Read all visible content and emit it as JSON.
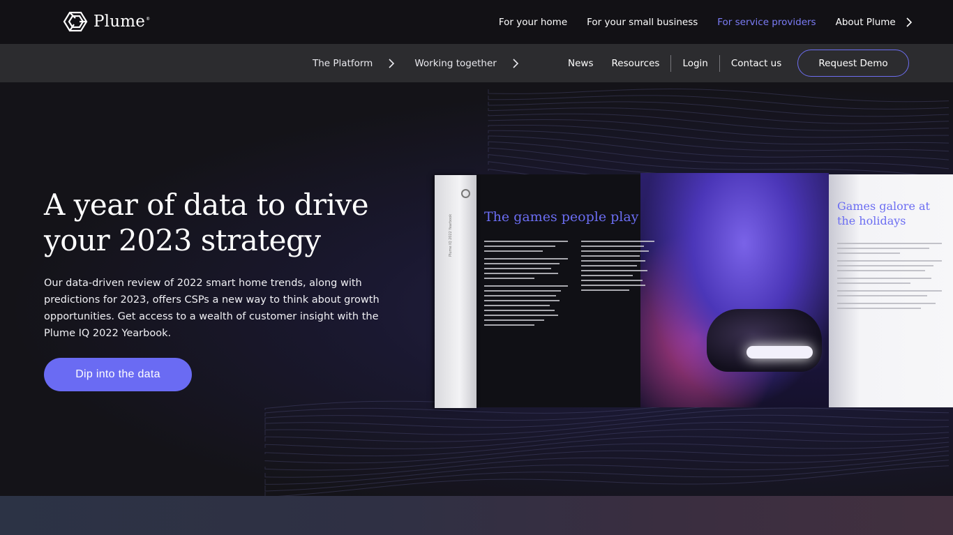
{
  "brand": {
    "name": "Plume",
    "tm": "®"
  },
  "top_nav": {
    "items": [
      {
        "label": "For your home",
        "active": false
      },
      {
        "label": "For your small business",
        "active": false
      },
      {
        "label": "For service providers",
        "active": true
      },
      {
        "label": "About Plume",
        "active": false
      }
    ]
  },
  "sub_nav": {
    "platform": "The Platform",
    "working_together": "Working together",
    "news": "News",
    "resources": "Resources",
    "login": "Login",
    "contact": "Contact us",
    "demo": "Request Demo"
  },
  "hero": {
    "title": "A year of data to drive your 2023 strategy",
    "description": "Our data-driven review of 2022 smart home trends, along with predictions for 2023, offers CSPs a new way to think about growth opportunities. Get access to a wealth of customer insight with the Plume IQ 2022 Yearbook.",
    "cta": "Dip into the data"
  },
  "book": {
    "left_heading": "The games people play",
    "right_heading": "Games galore at the holidays",
    "spine": "Plume IQ 2022 Yearbook"
  },
  "colors": {
    "accent": "#6a6bf3",
    "active_link": "#7b7cf6",
    "topbar": "#121115",
    "subbar": "#2c2c2f"
  }
}
